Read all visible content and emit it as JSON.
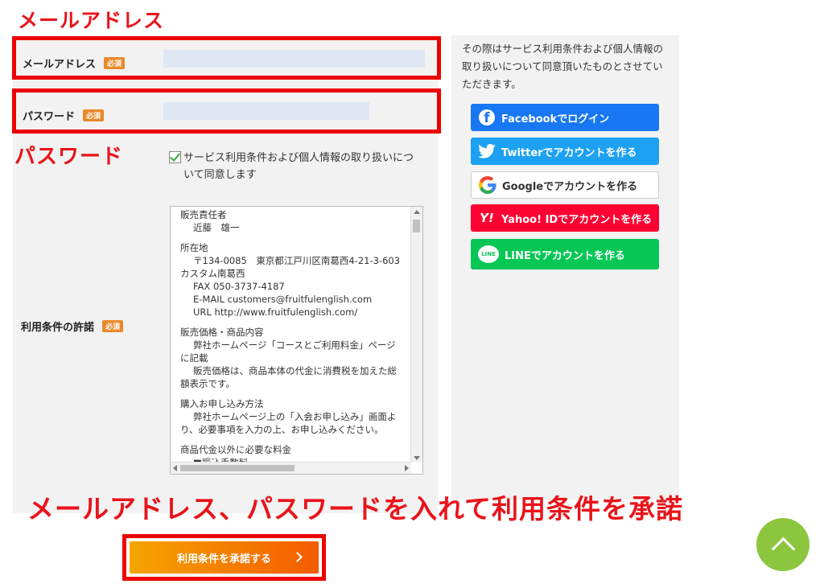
{
  "annotations": {
    "email": "メールアドレス",
    "password": "パスワード",
    "instruction": "メールアドレス、パスワードを入れて利用条件を承諾"
  },
  "form": {
    "email_label": "メールアドレス",
    "password_label": "パスワード",
    "required_badge": "必須",
    "agree_text": "サービス利用条件および個人情報の取り扱いについて同意します",
    "terms_label": "利用条件の許諾"
  },
  "terms": {
    "s1_title": "販売責任者",
    "s1_l1": "近藤　雄一",
    "s2_title": "所在地",
    "s2_l1": "〒134-0085　東京都江戸川区南葛西4-21-3-603　カスタム南葛西",
    "s2_l2": "FAX 050-3737-4187",
    "s2_l3": "E-MAIL customers@fruitfulenglish.com",
    "s2_l4": "URL http://www.fruitfulenglish.com/",
    "s3_title": "販売価格・商品内容",
    "s3_l1": "弊社ホームページ「コースとご利用料金」ページに記載",
    "s3_l2": "販売価格は、商品本体の代金に消費税を加えた総額表示です。",
    "s4_title": "購入お申し込み方法",
    "s4_l1": "弊社ホームページ上の「入会お申し込み」画面より、必要事項を入力の上、お申し込みください。",
    "s5_title": "商品代金以外に必要な料金",
    "s5_l1": "■振込手数料"
  },
  "submit_label": "利用条件を承諾する",
  "right": {
    "note": "その際はサービス利用条件および個人情報の取り扱いについて同意頂いたものとさせていただきます。",
    "facebook": "Facebookでログイン",
    "twitter": "Twitterでアカウントを作る",
    "google": "Googleでアカウントを作る",
    "yahoo": "Yahoo! IDでアカウントを作る",
    "line": "LINEでアカウントを作る",
    "yahoo_icon_text": "Y!",
    "line_icon_text": "LINE"
  },
  "colors": {
    "annotation_red": "#e8141a",
    "submit_gradient_start": "#f6a400",
    "submit_gradient_end": "#f35c00",
    "facebook": "#1877f2",
    "twitter": "#1da1f2",
    "yahoo": "#ff0033",
    "line": "#06c755",
    "to_top": "#8cc63e"
  },
  "icons": [
    "check-icon",
    "facebook-icon",
    "twitter-icon",
    "google-icon",
    "yahoo-icon",
    "line-icon",
    "chevron-right-icon",
    "chevron-up-icon"
  ]
}
